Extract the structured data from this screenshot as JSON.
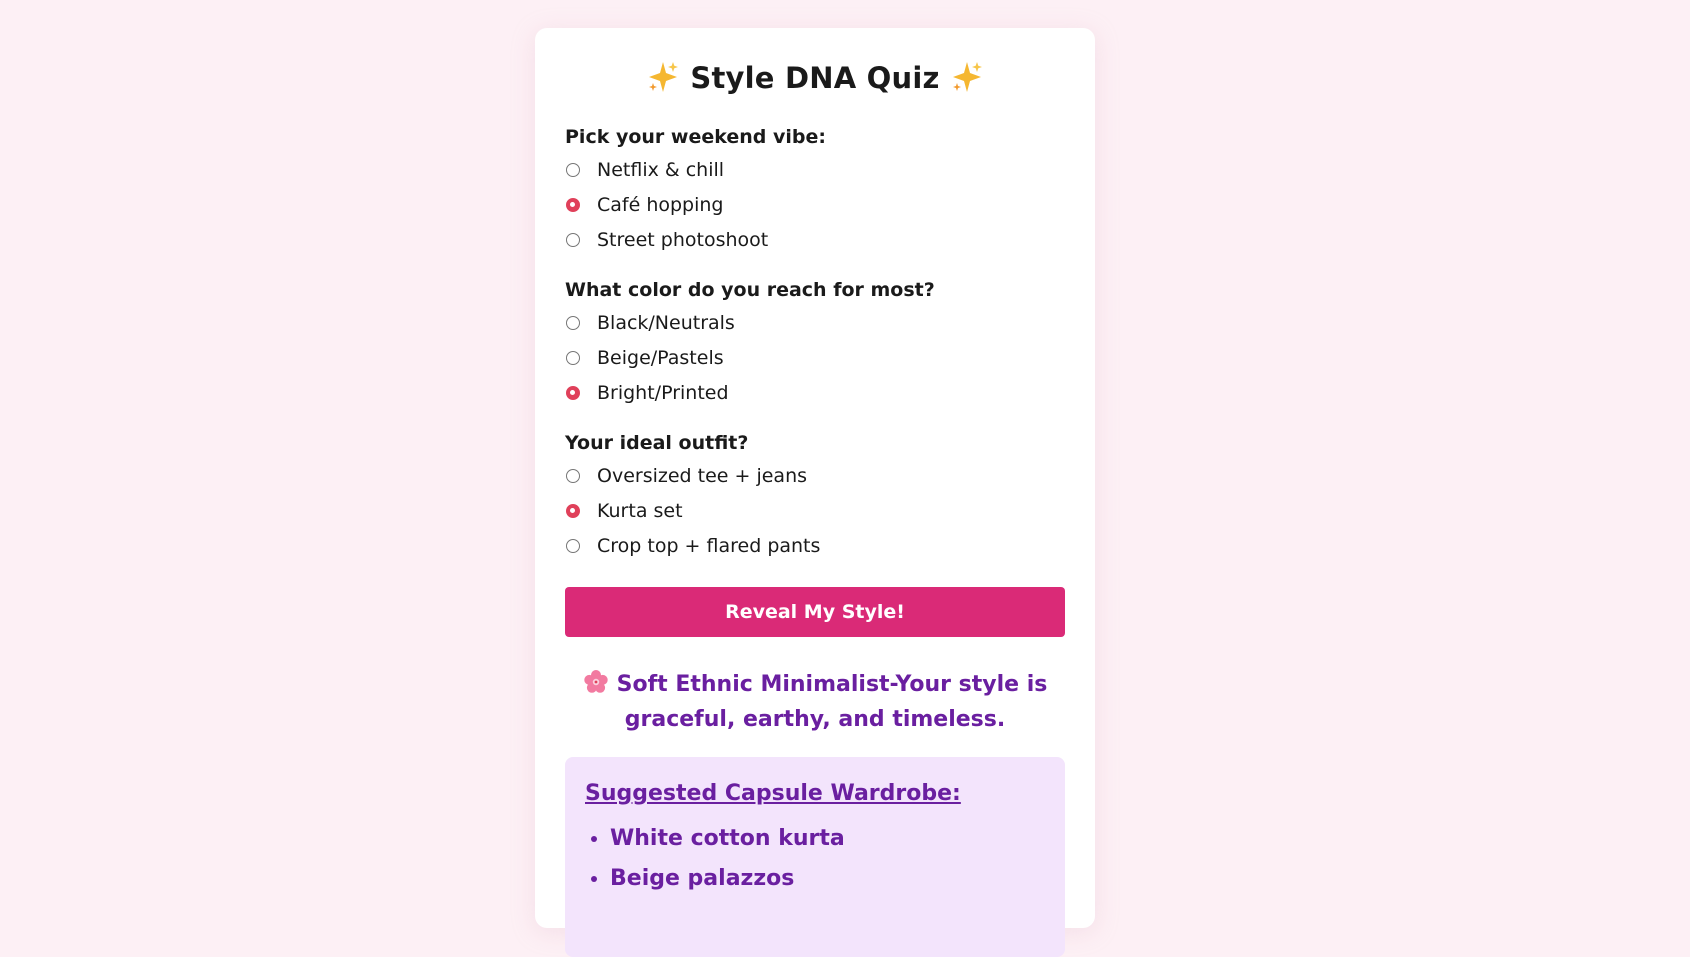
{
  "quiz": {
    "title": "Style DNA Quiz",
    "title_icon": "sparkles-icon",
    "questions": [
      {
        "label": "Pick your weekend vibe:",
        "options": [
          {
            "label": "Netflix & chill",
            "checked": false
          },
          {
            "label": "Café hopping",
            "checked": true
          },
          {
            "label": "Street photoshoot",
            "checked": false
          }
        ]
      },
      {
        "label": "What color do you reach for most?",
        "options": [
          {
            "label": "Black/Neutrals",
            "checked": false
          },
          {
            "label": "Beige/Pastels",
            "checked": false
          },
          {
            "label": "Bright/Printed",
            "checked": true
          }
        ]
      },
      {
        "label": "Your ideal outfit?",
        "options": [
          {
            "label": "Oversized tee + jeans",
            "checked": false
          },
          {
            "label": "Kurta set",
            "checked": true
          },
          {
            "label": "Crop top + flared pants",
            "checked": false
          }
        ]
      }
    ],
    "submit_label": "Reveal My Style!"
  },
  "result": {
    "icon": "cherry-blossom-icon",
    "text": "Soft Ethnic Minimalist-Your style is graceful, earthy, and timeless."
  },
  "capsule": {
    "title": "Suggested Capsule Wardrobe:",
    "items": [
      "White cotton kurta",
      "Beige palazzos"
    ]
  },
  "colors": {
    "page_background": "#fdf0f5",
    "accent_button": "#da2a77",
    "radio_checked": "#e0405a",
    "result_text": "#6a1fa0",
    "capsule_background": "#f3e4fc"
  }
}
